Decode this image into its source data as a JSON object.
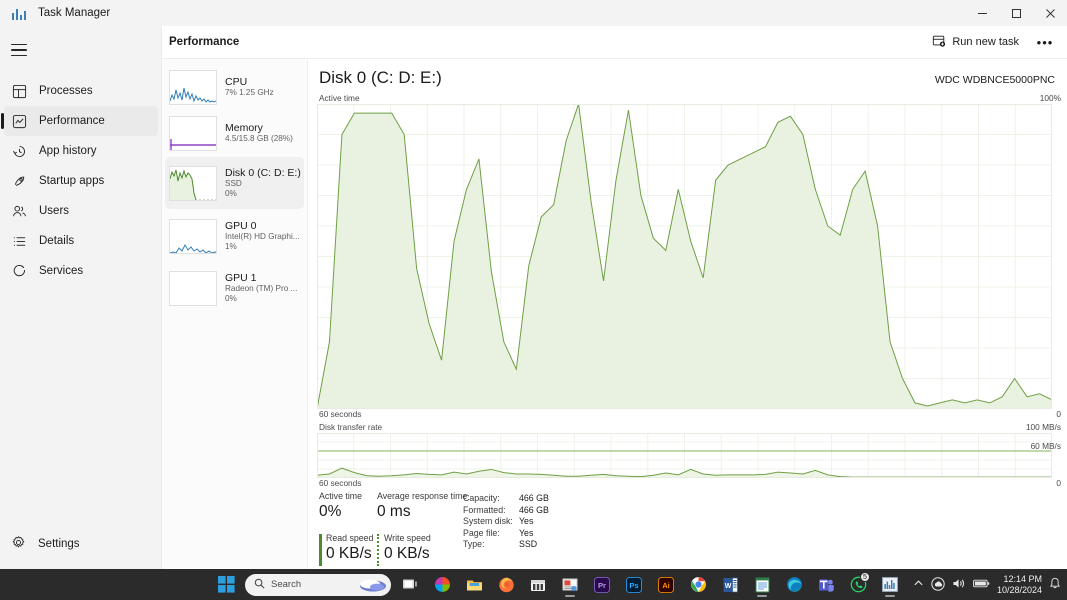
{
  "window": {
    "title": "Task Manager",
    "app_icon": "task-manager-icon",
    "minimize": "–",
    "maximize": "❐",
    "close": "✕"
  },
  "sidebar": {
    "hamburger": "menu-icon",
    "items": [
      {
        "label": "Processes",
        "icon": "processes-icon",
        "active": false
      },
      {
        "label": "Performance",
        "icon": "performance-icon",
        "active": true
      },
      {
        "label": "App history",
        "icon": "history-icon",
        "active": false
      },
      {
        "label": "Startup apps",
        "icon": "startup-icon",
        "active": false
      },
      {
        "label": "Users",
        "icon": "users-icon",
        "active": false
      },
      {
        "label": "Details",
        "icon": "details-icon",
        "active": false
      },
      {
        "label": "Services",
        "icon": "services-icon",
        "active": false
      }
    ],
    "settings": {
      "label": "Settings",
      "icon": "gear-icon"
    }
  },
  "header": {
    "title": "Performance",
    "run_new_task": "Run new task",
    "run_new_task_icon": "run-task-icon",
    "more_options": "•••"
  },
  "devices": [
    {
      "name": "CPU",
      "line1": "7%  1.25 GHz",
      "line2": "",
      "color": "#2f7fb8",
      "active": false
    },
    {
      "name": "Memory",
      "line1": "4.5/15.8 GB (28%)",
      "line2": "",
      "color": "#8e44c4",
      "active": false
    },
    {
      "name": "Disk 0 (C: D: E:)",
      "line1": "SSD",
      "line2": "0%",
      "color": "#4f8a2e",
      "active": true
    },
    {
      "name": "GPU 0",
      "line1": "Intel(R) HD Graphi...",
      "line2": "1%",
      "color": "#2f7fb8",
      "active": false
    },
    {
      "name": "GPU 1",
      "line1": "Radeon (TM) Pro ...",
      "line2": "0%",
      "color": "#2f7fb8",
      "active": false
    }
  ],
  "main": {
    "title": "Disk 0 (C: D: E:)",
    "model": "WDC  WDBNCE5000PNC"
  },
  "chart_data": [
    {
      "type": "area",
      "title": "Active time",
      "xlabel": "60 seconds",
      "ylabel": "",
      "ymax_label": "100%",
      "ymin_label": "0",
      "ylim": [
        0,
        100
      ],
      "grid": true,
      "line_color": "#6f9f45",
      "fill_color": "#e9f2e0",
      "x": [
        0,
        1,
        2,
        3,
        4,
        5,
        6,
        7,
        8,
        9,
        10,
        11,
        12,
        13,
        14,
        15,
        16,
        17,
        18,
        19,
        20,
        21,
        22,
        23,
        24,
        25,
        26,
        27,
        28,
        29,
        30,
        31,
        32,
        33,
        34,
        35,
        36,
        37,
        38,
        39,
        40,
        41,
        42,
        43,
        44,
        45,
        46,
        47,
        48,
        49,
        50,
        51,
        52,
        53,
        54,
        55,
        56,
        57,
        58,
        59
      ],
      "values": [
        0,
        22,
        90,
        97,
        97,
        97,
        97,
        90,
        46,
        28,
        16,
        55,
        72,
        82,
        45,
        22,
        13,
        47,
        63,
        67,
        88,
        100,
        68,
        42,
        75,
        98,
        70,
        56,
        52,
        72,
        55,
        43,
        75,
        80,
        82,
        84,
        86,
        94,
        96,
        90,
        72,
        60,
        57,
        72,
        78,
        60,
        22,
        10,
        2,
        1,
        2,
        3,
        2,
        3,
        2,
        4,
        10,
        4,
        5,
        3
      ]
    },
    {
      "type": "area",
      "title": "Disk transfer rate",
      "xlabel": "60 seconds",
      "ymax_label": "100 MB/s",
      "ymin_label": "0",
      "reference_line_label": "60 MB/s",
      "reference_line_value": 60,
      "ylim": [
        0,
        100
      ],
      "grid": true,
      "line_color": "#6f9f45",
      "fill_color": "#eef5e6",
      "x": [
        0,
        1,
        2,
        3,
        4,
        5,
        6,
        7,
        8,
        9,
        10,
        11,
        12,
        13,
        14,
        15,
        16,
        17,
        18,
        19,
        20,
        21,
        22,
        23,
        24,
        25,
        26,
        27,
        28,
        29,
        30,
        31,
        32,
        33,
        34,
        35,
        36,
        37,
        38,
        39,
        40,
        41,
        42,
        43,
        44,
        45,
        46,
        47,
        48,
        49,
        50,
        51,
        52,
        53,
        54,
        55,
        56,
        57,
        58,
        59
      ],
      "values": [
        6,
        9,
        22,
        12,
        5,
        4,
        5,
        7,
        10,
        8,
        7,
        13,
        9,
        15,
        19,
        12,
        9,
        9,
        8,
        6,
        4,
        4,
        6,
        8,
        5,
        4,
        3,
        6,
        11,
        7,
        19,
        9,
        6,
        7,
        7,
        7,
        8,
        13,
        11,
        9,
        17,
        7,
        3,
        2,
        2,
        2,
        2,
        2,
        2,
        2,
        2,
        2,
        2,
        2,
        2,
        2,
        2,
        2,
        2,
        2
      ]
    }
  ],
  "stats": {
    "active_time": {
      "label": "Active time",
      "value": "0%"
    },
    "avg_response": {
      "label": "Average response time",
      "value": "0 ms"
    },
    "read_speed": {
      "label": "Read speed",
      "value": "0 KB/s"
    },
    "write_speed": {
      "label": "Write speed",
      "value": "0 KB/s"
    },
    "info": [
      {
        "key": "Capacity:",
        "value": "466 GB"
      },
      {
        "key": "Formatted:",
        "value": "466 GB"
      },
      {
        "key": "System disk:",
        "value": "Yes"
      },
      {
        "key": "Page file:",
        "value": "Yes"
      },
      {
        "key": "Type:",
        "value": "SSD"
      }
    ]
  },
  "taskbar": {
    "start": "start-icon",
    "search_placeholder": "Search",
    "search_icon": "search-icon",
    "items": [
      {
        "name": "task-view-icon",
        "running": false
      },
      {
        "name": "copilot-icon",
        "running": false
      },
      {
        "name": "file-explorer-icon",
        "running": false
      },
      {
        "name": "firefox-icon",
        "running": false
      },
      {
        "name": "microsoft-store-icon",
        "running": false
      },
      {
        "name": "media-player-icon",
        "running": true
      },
      {
        "name": "premiere-pro-icon",
        "running": false
      },
      {
        "name": "photoshop-icon",
        "running": false
      },
      {
        "name": "illustrator-icon",
        "running": false
      },
      {
        "name": "chrome-icon",
        "running": false
      },
      {
        "name": "word-icon",
        "running": false
      },
      {
        "name": "notepad-icon",
        "running": true
      },
      {
        "name": "edge-icon",
        "running": false
      },
      {
        "name": "teams-icon",
        "running": false
      },
      {
        "name": "whatsapp-icon",
        "running": false,
        "badge": "5"
      },
      {
        "name": "task-manager-icon",
        "running": true
      }
    ],
    "tray": {
      "chevron": "show-hidden-icons",
      "onedrive": "onedrive-icon",
      "volume": "volume-icon",
      "battery": "battery-icon",
      "time": "12:14 PM",
      "date": "10/28/2024",
      "notifications": "notifications-icon"
    }
  }
}
